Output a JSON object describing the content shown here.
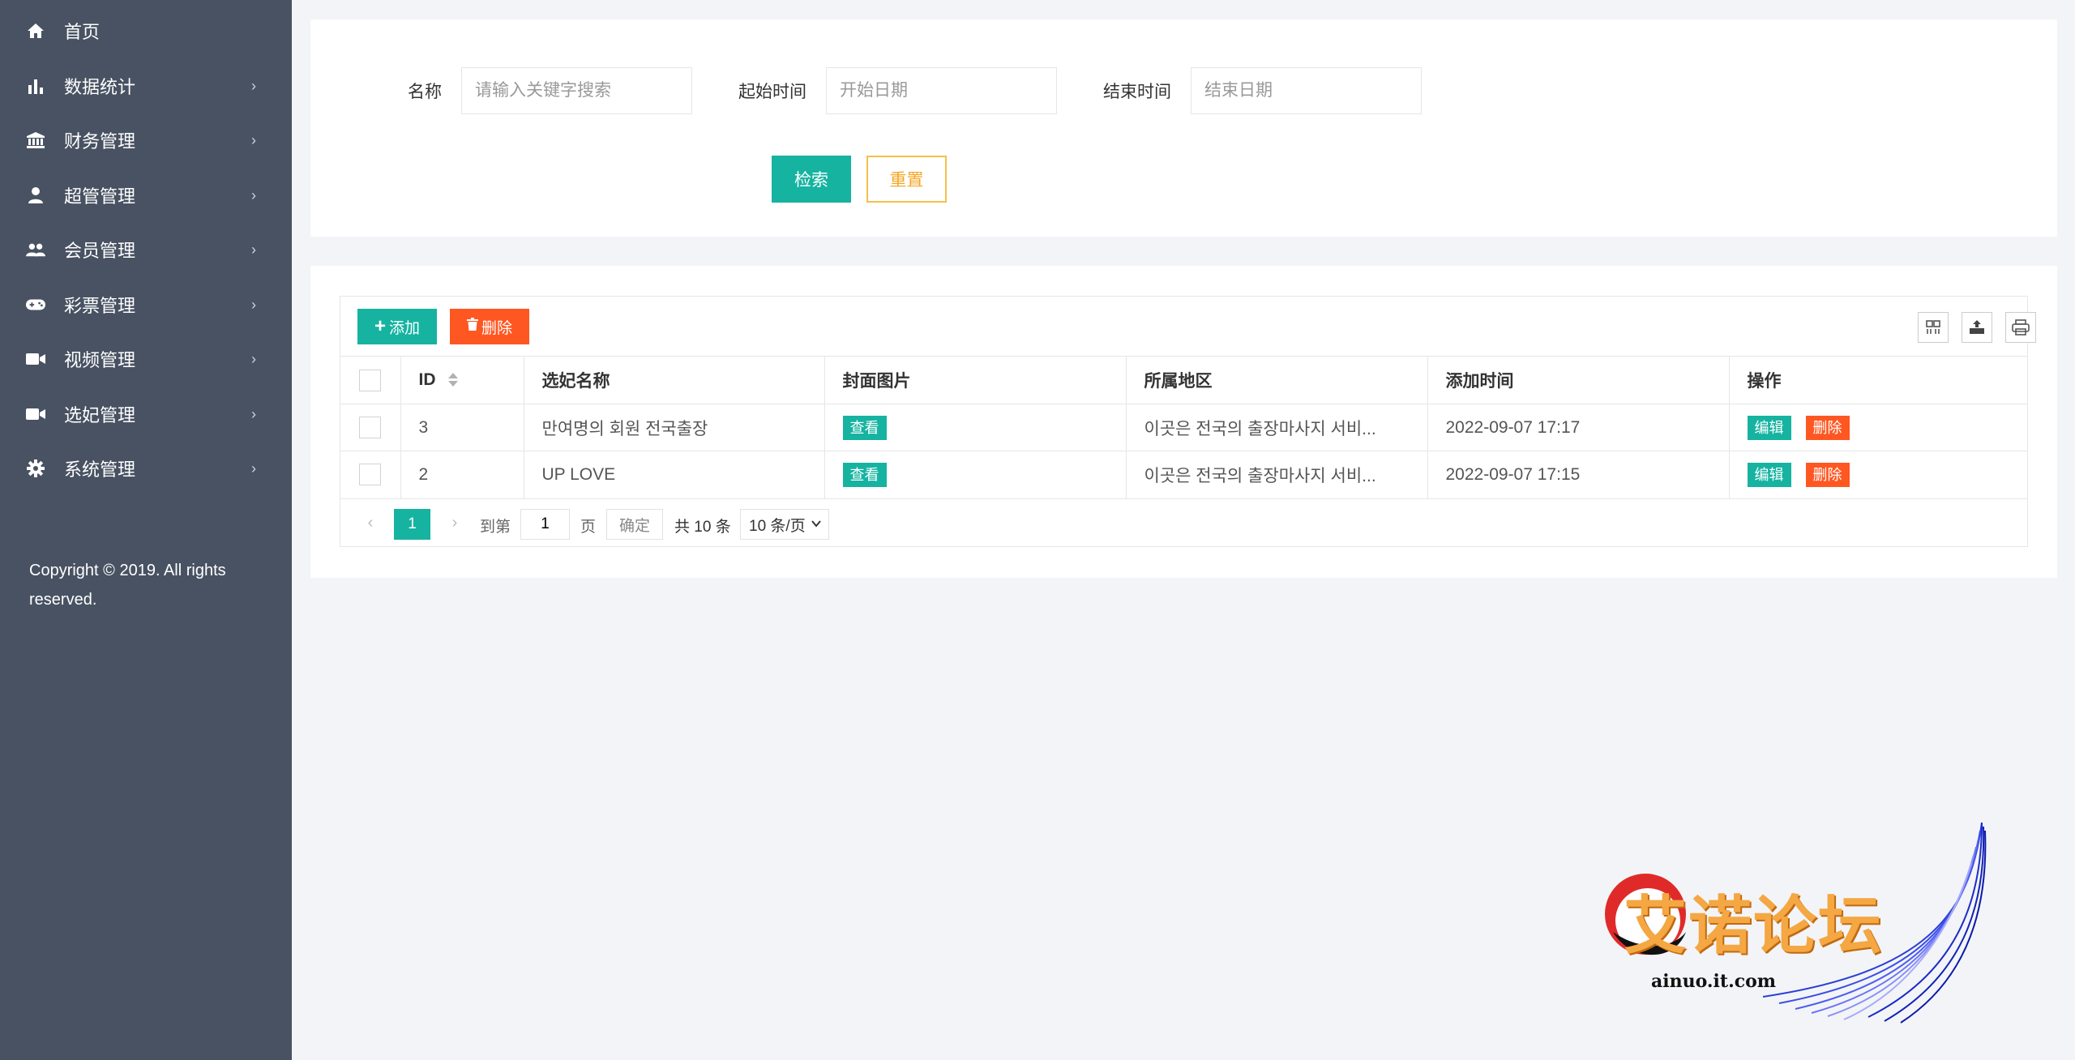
{
  "sidebar": {
    "items": [
      {
        "label": "首页",
        "icon": "home-icon",
        "has_arrow": false
      },
      {
        "label": "数据统计",
        "icon": "bar-chart-icon",
        "has_arrow": true
      },
      {
        "label": "财务管理",
        "icon": "bank-icon",
        "has_arrow": true
      },
      {
        "label": "超管管理",
        "icon": "user-icon",
        "has_arrow": true
      },
      {
        "label": "会员管理",
        "icon": "users-icon",
        "has_arrow": true
      },
      {
        "label": "彩票管理",
        "icon": "gamepad-icon",
        "has_arrow": true
      },
      {
        "label": "视频管理",
        "icon": "video-camera-icon",
        "has_arrow": true
      },
      {
        "label": "选妃管理",
        "icon": "video-camera-icon",
        "has_arrow": true
      },
      {
        "label": "系统管理",
        "icon": "gear-icon",
        "has_arrow": true
      }
    ],
    "arrow": "›",
    "copyright": "Copyright © 2019. All rights reserved."
  },
  "search": {
    "name_label": "名称",
    "name_placeholder": "请输入关键字搜索",
    "start_label": "起始时间",
    "start_placeholder": "开始日期",
    "end_label": "结束时间",
    "end_placeholder": "结束日期",
    "search_button": "检索",
    "reset_button": "重置"
  },
  "toolbar": {
    "add_label": "添加",
    "delete_label": "删除",
    "tool_icons": [
      "columns-filter-icon",
      "export-icon",
      "print-icon"
    ]
  },
  "table": {
    "columns": [
      "ID",
      "选妃名称",
      "封面图片",
      "所属地区",
      "添加时间",
      "操作"
    ],
    "rows": [
      {
        "id": "3",
        "name": "만여명의 회원 전국출장",
        "cover": "查看",
        "region": "이곳은 전국의 출장마사지 서비...",
        "time": "2022-09-07 17:17",
        "edit": "编辑",
        "delete": "删除"
      },
      {
        "id": "2",
        "name": "UP LOVE",
        "cover": "查看",
        "region": "이곳은 전국의 출장마사지 서비...",
        "time": "2022-09-07 17:15",
        "edit": "编辑",
        "delete": "删除"
      }
    ]
  },
  "pagination": {
    "current_page": "1",
    "goto_label": "到第",
    "goto_value": "1",
    "page_suffix": "页",
    "confirm": "确定",
    "total": "共 10 条",
    "page_size": "10 条/页"
  },
  "watermark": {
    "title": "艾诺论坛",
    "url": "ainuo.it.com"
  },
  "colors": {
    "sidebar_bg": "#485262",
    "primary": "#16b3a1",
    "danger": "#ff5722",
    "reset_border": "#f5c04a",
    "page_bg": "#f3f4f7"
  }
}
